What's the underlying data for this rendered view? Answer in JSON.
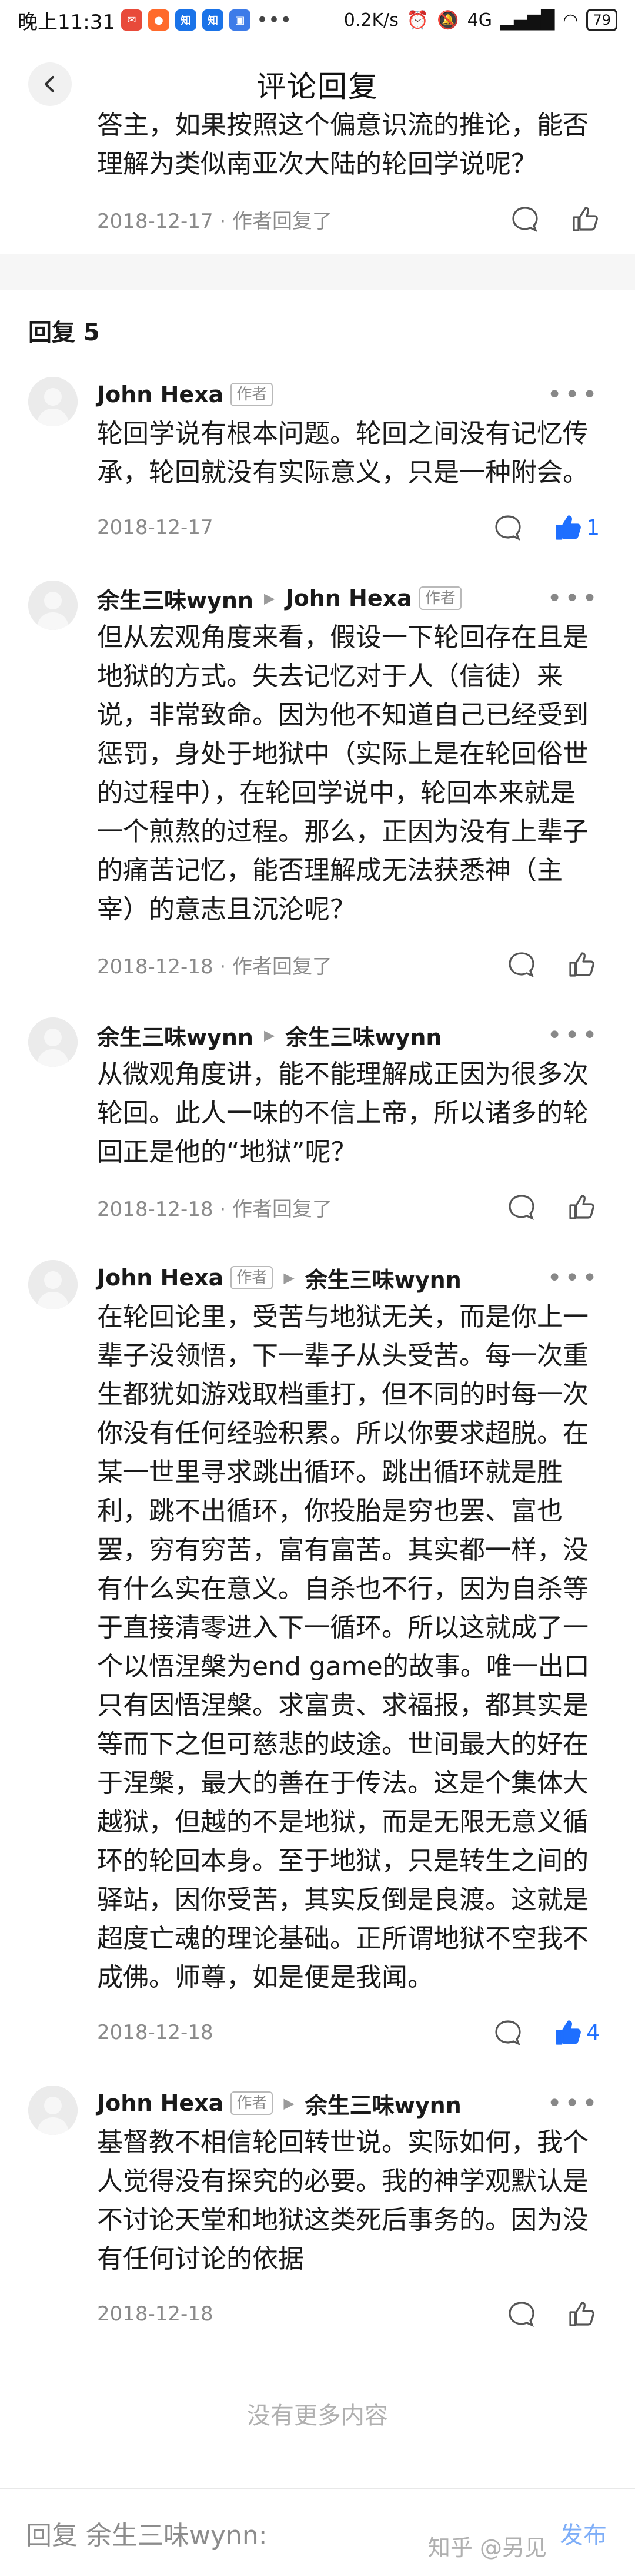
{
  "status_bar": {
    "time": "晚上11:31",
    "speed": "0.2K/s",
    "battery": "79",
    "signal": "4G"
  },
  "nav": {
    "title": "评论回复",
    "back_icon": "chevron-left-icon"
  },
  "parent": {
    "text": "答主，如果按照这个偏意识流的推论，能否理解为类似南亚次大陆的轮回学说呢？",
    "date": "2018-12-17",
    "meta_suffix": "作者回复了"
  },
  "section": {
    "title": "回复 5"
  },
  "comments": [
    {
      "author": "John Hexa",
      "author_tag": "作者",
      "reply_to": "",
      "reply_to_tag": "",
      "text": "轮回学说有根本问题。轮回之间没有记忆传承，轮回就没有实际意义，只是一种附会。",
      "date": "2018-12-17",
      "meta_suffix": "",
      "likes": "1",
      "liked": true
    },
    {
      "author": "余生三味wynn",
      "author_tag": "",
      "reply_to": "John Hexa",
      "reply_to_tag": "作者",
      "text": "但从宏观角度来看，假设一下轮回存在且是地狱的方式。失去记忆对于人（信徒）来说，非常致命。因为他不知道自己已经受到惩罚，身处于地狱中（实际上是在轮回俗世的过程中），在轮回学说中，轮回本来就是一个煎熬的过程。那么，正因为没有上辈子的痛苦记忆，能否理解成无法获悉神（主宰）的意志且沉沦呢？",
      "date": "2018-12-18",
      "meta_suffix": "作者回复了",
      "likes": "",
      "liked": false
    },
    {
      "author": "余生三味wynn",
      "author_tag": "",
      "reply_to": "余生三味wynn",
      "reply_to_tag": "",
      "text": "从微观角度讲，能不能理解成正因为很多次轮回。此人一味的不信上帝，所以诸多的轮回正是他的“地狱”呢？",
      "date": "2018-12-18",
      "meta_suffix": "作者回复了",
      "likes": "",
      "liked": false
    },
    {
      "author": "John Hexa",
      "author_tag": "作者",
      "reply_to": "余生三味wynn",
      "reply_to_tag": "",
      "text": "在轮回论里，受苦与地狱无关，而是你上一辈子没领悟，下一辈子从头受苦。每一次重生都犹如游戏取档重打，但不同的时每一次你没有任何经验积累。所以你要求超脱。在某一世里寻求跳出循环。跳出循环就是胜利，跳不出循环，你投胎是穷也罢、富也罢，穷有穷苦，富有富苦。其实都一样，没有什么实在意义。自杀也不行，因为自杀等于直接清零进入下一循环。所以这就成了一个以悟涅槃为end game的故事。唯一出口只有因悟涅槃。求富贵、求福报，都其实是等而下之但可慈悲的歧途。世间最大的好在于涅槃，最大的善在于传法。这是个集体大越狱，但越的不是地狱，而是无限无意义循环的轮回本身。至于地狱，只是转生之间的驿站，因你受苦，其实反倒是良渡。这就是超度亡魂的理论基础。正所谓地狱不空我不成佛。师尊，如是便是我闻。",
      "date": "2018-12-18",
      "meta_suffix": "",
      "likes": "4",
      "liked": true
    },
    {
      "author": "John Hexa",
      "author_tag": "作者",
      "reply_to": "余生三味wynn",
      "reply_to_tag": "",
      "text": "基督教不相信轮回转世说。实际如何，我个人觉得没有探究的必要。我的神学观默认是不讨论天堂和地狱这类死后事务的。因为没有任何讨论的依据",
      "date": "2018-12-18",
      "meta_suffix": "",
      "likes": "",
      "liked": false
    }
  ],
  "end_text": "没有更多内容",
  "bottom": {
    "reply_placeholder": "回复 余生三味wynn:",
    "send_label": "发布"
  },
  "watermark": "知乎 @另见",
  "colors": {
    "accent": "#1e6fff",
    "muted": "#8a8a8a",
    "send": "#7eaef8"
  }
}
